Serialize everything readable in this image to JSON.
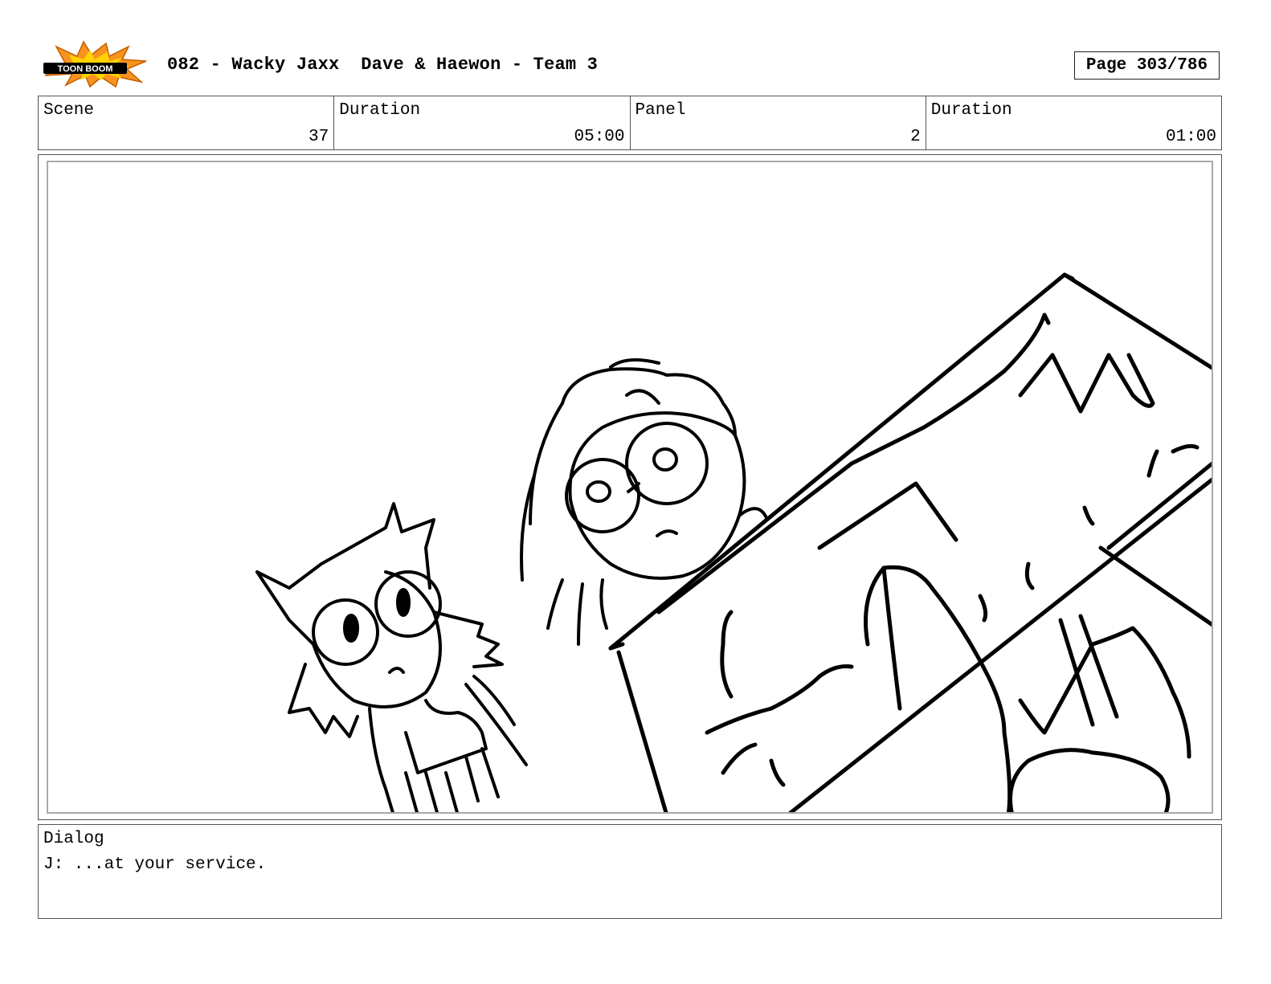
{
  "header": {
    "logo_text": "TOON BOOM",
    "title": "082 - Wacky Jaxx  Dave & Haewon - Team 3",
    "page_label": "Page 303/786"
  },
  "info": {
    "scene_label": "Scene",
    "scene_value": "37",
    "scene_duration_label": "Duration",
    "scene_duration_value": "05:00",
    "panel_label": "Panel",
    "panel_value": "2",
    "panel_duration_label": "Duration",
    "panel_duration_value": "01:00"
  },
  "dialog": {
    "label": "Dialog",
    "text": "J: ...at your service."
  },
  "colors": {
    "logo_burst": "#f7941d",
    "logo_burst_inner": "#ffd200",
    "line": "#000000"
  }
}
